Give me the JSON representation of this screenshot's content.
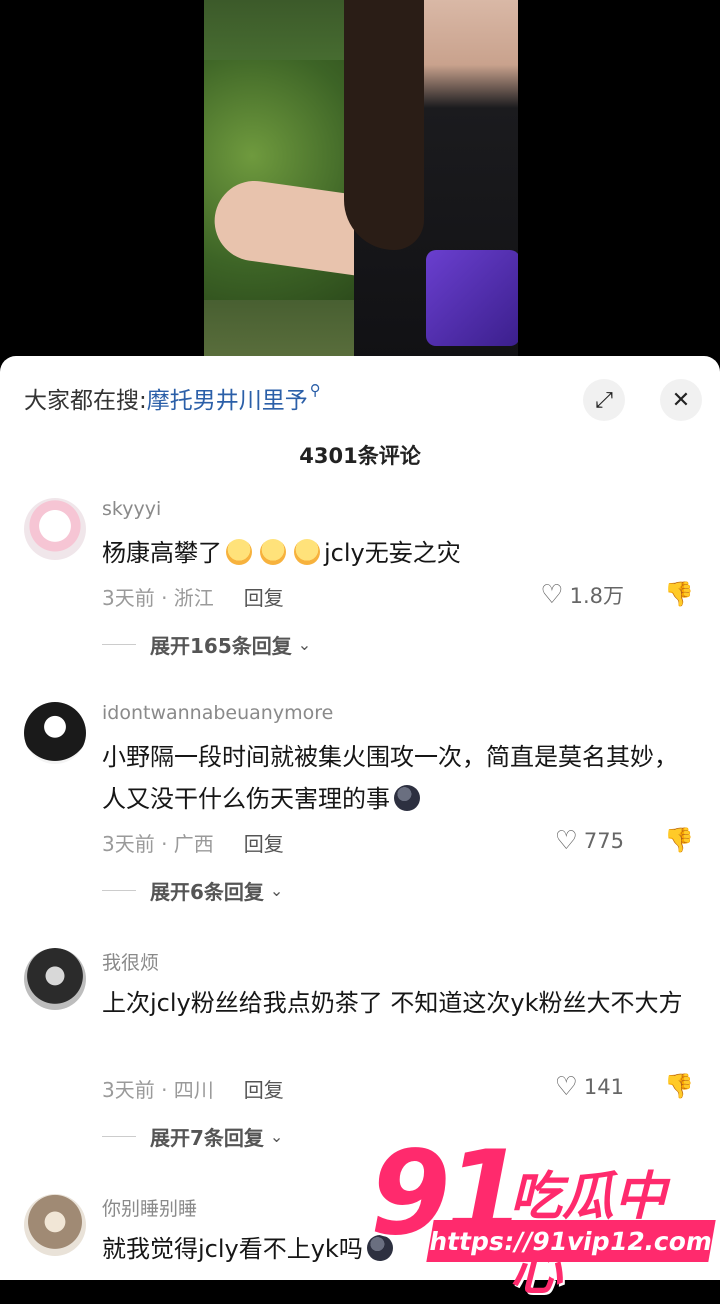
{
  "search": {
    "prefix": "大家都在搜: ",
    "term": "摩托男井川里予",
    "icon": "search-icon"
  },
  "header": {
    "comment_count": "4301条评论",
    "expand_icon": "expand-icon",
    "close_icon": "close-icon"
  },
  "comments": [
    {
      "username": "skyyyi",
      "text_before": "杨康高攀了",
      "text_after": "jcly无妄之灾",
      "time_location": "3天前 · 浙江",
      "reply_label": "回复",
      "likes": "1.8万",
      "expand_label": "展开165条回复"
    },
    {
      "username": "idontwannabeuanymore",
      "text": "小野隔一段时间就被集火围攻一次，简直是莫名其妙，人又没干什么伤天害理的事",
      "time_location": "3天前 · 广西",
      "reply_label": "回复",
      "likes": "775",
      "expand_label": "展开6条回复"
    },
    {
      "username": "我很烦",
      "text": "上次jcly粉丝给我点奶茶了 不知道这次yk粉丝大不大方",
      "time_location": "3天前 · 四川",
      "reply_label": "回复",
      "likes": "141",
      "expand_label": "展开7条回复"
    },
    {
      "username": "你别睡别睡",
      "text": "就我觉得jcly看不上yk吗"
    }
  ],
  "watermark": {
    "number": "91",
    "chinese": "吃瓜中心",
    "url": "https://91vip12.com"
  },
  "colors": {
    "search_term": "#2b5fa8",
    "watermark": "#ff2a6d"
  }
}
